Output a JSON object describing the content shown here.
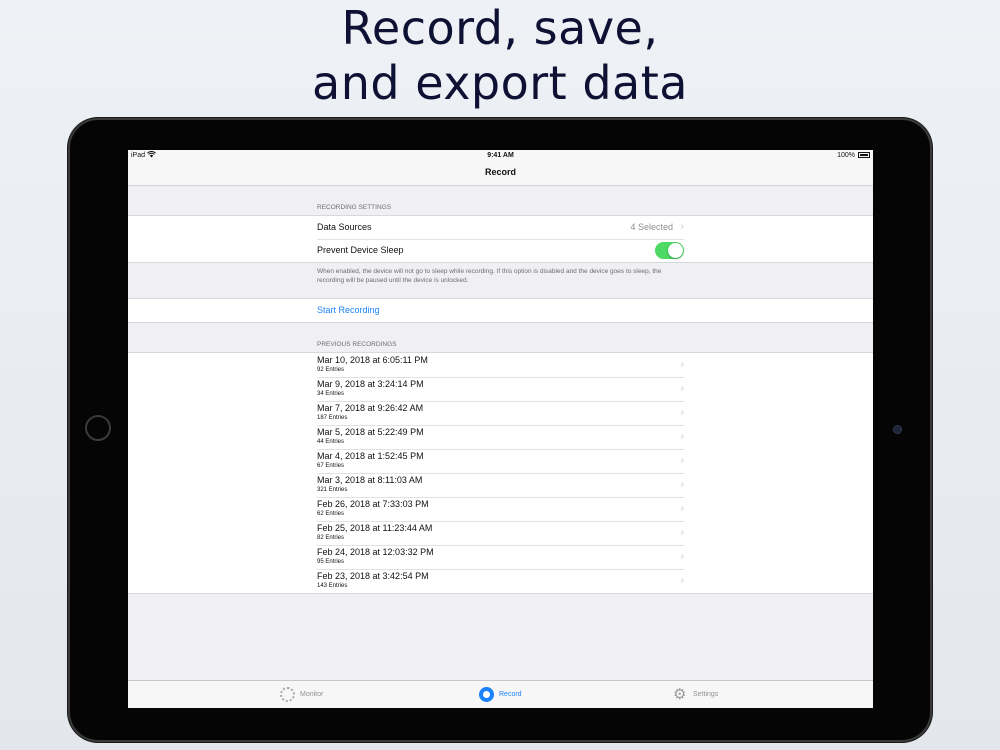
{
  "headline": {
    "line1": "Record, save,",
    "line2": "and export data"
  },
  "status_bar": {
    "device": "iPad",
    "time": "9:41 AM",
    "battery": "100%"
  },
  "nav": {
    "title": "Record"
  },
  "recording_settings": {
    "header": "RECORDING SETTINGS",
    "data_sources": {
      "label": "Data Sources",
      "value": "4 Selected"
    },
    "prevent_sleep": {
      "label": "Prevent Device Sleep",
      "enabled": true
    },
    "footnote": "When enabled, the device will not go to sleep while recording. If this option is disabled and the device goes to sleep, the recording will be paused until the device is unlocked."
  },
  "start_recording": {
    "label": "Start Recording"
  },
  "previous_recordings": {
    "header": "PREVIOUS RECORDINGS",
    "items": [
      {
        "date": "Mar 10, 2018 at 6:05:11 PM",
        "entries": "92 Entries"
      },
      {
        "date": "Mar 9, 2018 at 3:24:14 PM",
        "entries": "34 Entries"
      },
      {
        "date": "Mar 7, 2018 at 9:26:42 AM",
        "entries": "187 Entries"
      },
      {
        "date": "Mar 5, 2018 at 5:22:49 PM",
        "entries": "44 Entries"
      },
      {
        "date": "Mar 4, 2018 at 1:52:45 PM",
        "entries": "67 Entries"
      },
      {
        "date": "Mar 3, 2018 at 8:11:03 AM",
        "entries": "321 Entries"
      },
      {
        "date": "Feb 26, 2018 at 7:33:03 PM",
        "entries": "62 Entries"
      },
      {
        "date": "Feb 25, 2018 at 11:23:44 AM",
        "entries": "82 Entries"
      },
      {
        "date": "Feb 24, 2018 at 12:03:32 PM",
        "entries": "95 Entries"
      },
      {
        "date": "Feb 23, 2018 at 3:42:54 PM",
        "entries": "143 Entries"
      }
    ]
  },
  "tabbar": {
    "tabs": [
      {
        "label": "Monitor",
        "icon": "monitor-icon",
        "active": false
      },
      {
        "label": "Record",
        "icon": "record-icon",
        "active": true
      },
      {
        "label": "Settings",
        "icon": "gear-icon",
        "active": false
      }
    ]
  },
  "colors": {
    "accent": "#1a82fb",
    "toggle_on": "#4cd964",
    "headline": "#0e1133"
  }
}
